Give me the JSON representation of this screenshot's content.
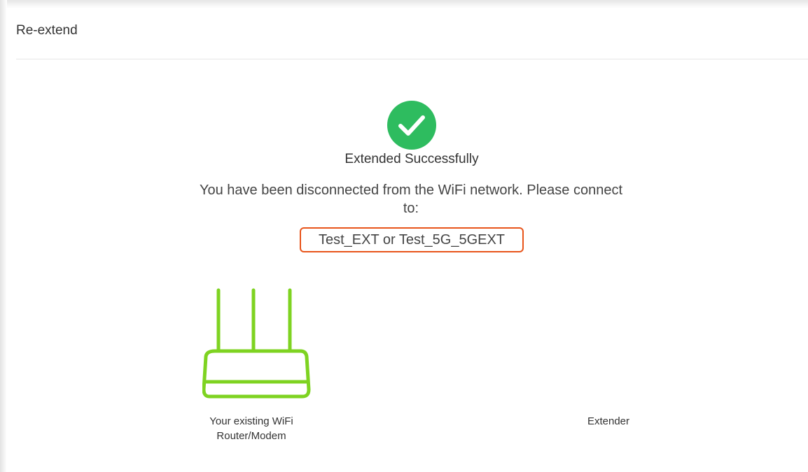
{
  "header": {
    "title": "Re-extend"
  },
  "status": {
    "icon": "check-circle-icon",
    "title": "Extended Successfully",
    "message": "You have been disconnected from the WiFi network. Please connect to:",
    "ssids": "Test_EXT or Test_5G_5GEXT"
  },
  "diagram": {
    "router_icon": "router-icon",
    "router_label_line1": "Your existing WiFi",
    "router_label_line2": "Router/Modem",
    "extender_label": "Extender"
  },
  "colors": {
    "success": "#2ebc5f",
    "router_green": "#7ed321",
    "highlight_border": "#e8541a"
  }
}
